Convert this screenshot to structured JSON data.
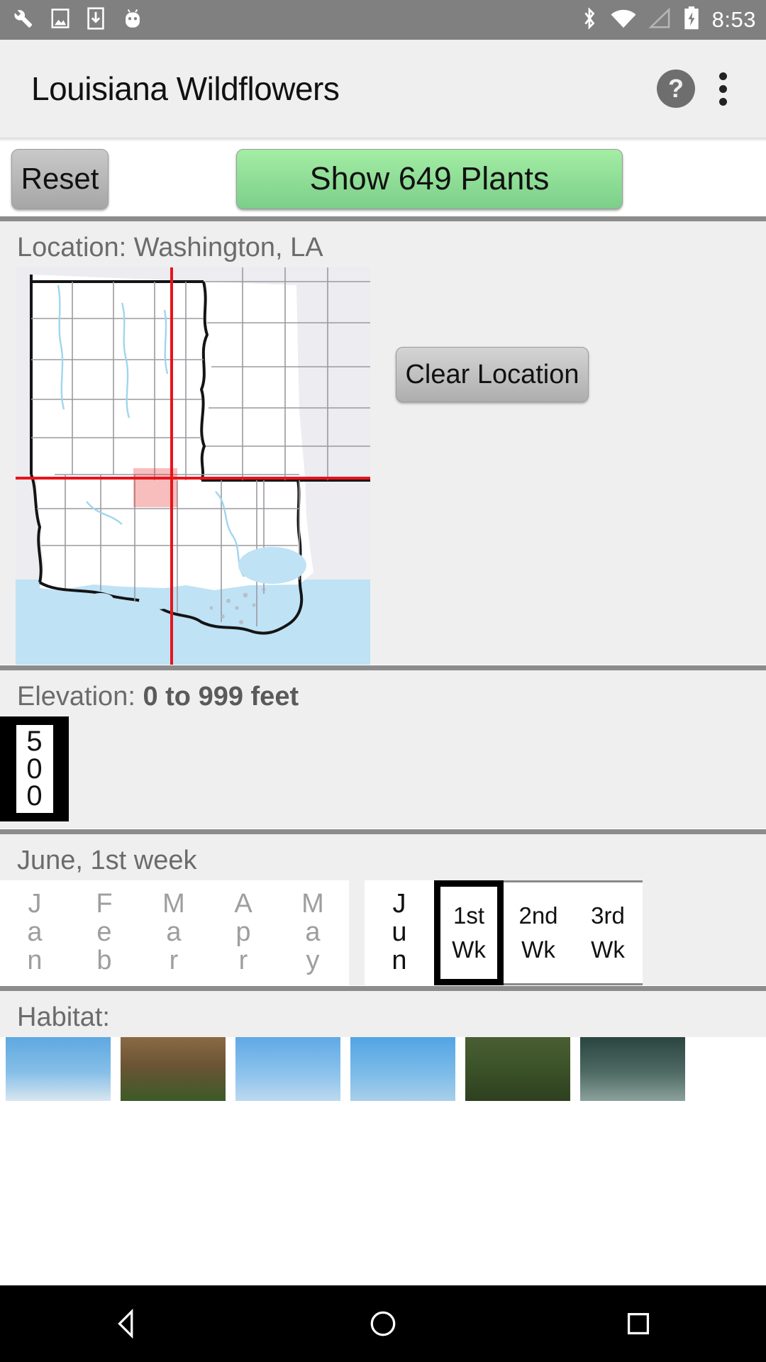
{
  "status_bar": {
    "icons": [
      "wrench-icon",
      "screenshot-icon",
      "download-icon",
      "android-icon",
      "bluetooth-icon",
      "wifi-icon",
      "cell-signal-icon",
      "battery-charging-icon"
    ],
    "time": "8:53"
  },
  "app_bar": {
    "title": "Louisiana Wildflowers",
    "help_label": "?",
    "overflow_label": "More options"
  },
  "toolbar": {
    "reset_label": "Reset",
    "show_label": "Show 649 Plants",
    "plant_count": 649,
    "show_button_color": "#7bcf8a"
  },
  "location": {
    "label": "Location: Washington, LA",
    "place": "Washington, LA",
    "clear_label": "Clear Location",
    "crosshair_color": "#e8141b",
    "highlight_color": "#f3b3b3"
  },
  "elevation": {
    "label_prefix": "Elevation: ",
    "label_value": "0 to 999 feet",
    "range_min": 0,
    "range_max": 999,
    "units": "feet",
    "tile_value": "500",
    "tile_digits": [
      "5",
      "0",
      "0"
    ]
  },
  "season": {
    "label": "June, 1st week",
    "month_selected": "Jun",
    "week_selected": "1st Wk",
    "months": [
      {
        "label": "Jan",
        "letters": [
          "J",
          "a",
          "n"
        ],
        "selected": false
      },
      {
        "label": "Feb",
        "letters": [
          "F",
          "e",
          "b"
        ],
        "selected": false
      },
      {
        "label": "Mar",
        "letters": [
          "M",
          "a",
          "r"
        ],
        "selected": false
      },
      {
        "label": "Apr",
        "letters": [
          "A",
          "p",
          "r"
        ],
        "selected": false
      },
      {
        "label": "May",
        "letters": [
          "M",
          "a",
          "y"
        ],
        "selected": false
      }
    ],
    "month_in_week_strip": {
      "label": "Jun",
      "letters": [
        "J",
        "u",
        "n"
      ],
      "selected": true
    },
    "weeks": [
      {
        "ordinal": "1st",
        "unit": "Wk",
        "selected": true
      },
      {
        "ordinal": "2nd",
        "unit": "Wk",
        "selected": false
      },
      {
        "ordinal": "3rd",
        "unit": "Wk",
        "selected": false
      }
    ]
  },
  "habitat": {
    "label": "Habitat:",
    "thumbnails": [
      {
        "name": "mountain-habitat-thumb",
        "top": "#5ea8e0",
        "bottom": "#cfe3f2"
      },
      {
        "name": "rocky-ground-habitat-thumb",
        "top": "#8a6a46",
        "bottom": "#3d5a28"
      },
      {
        "name": "open-sky-habitat-thumb",
        "top": "#5fa9e6",
        "bottom": "#a9d2ee"
      },
      {
        "name": "prairie-habitat-thumb",
        "top": "#52a4e4",
        "bottom": "#9ecbe9"
      },
      {
        "name": "forest-habitat-thumb",
        "top": "#4a5e33",
        "bottom": "#2e4020"
      },
      {
        "name": "wetland-habitat-thumb",
        "top": "#2b4440",
        "bottom": "#6f8a84"
      }
    ]
  },
  "nav_bar": {
    "back_label": "Back",
    "home_label": "Home",
    "recents_label": "Recent apps"
  }
}
